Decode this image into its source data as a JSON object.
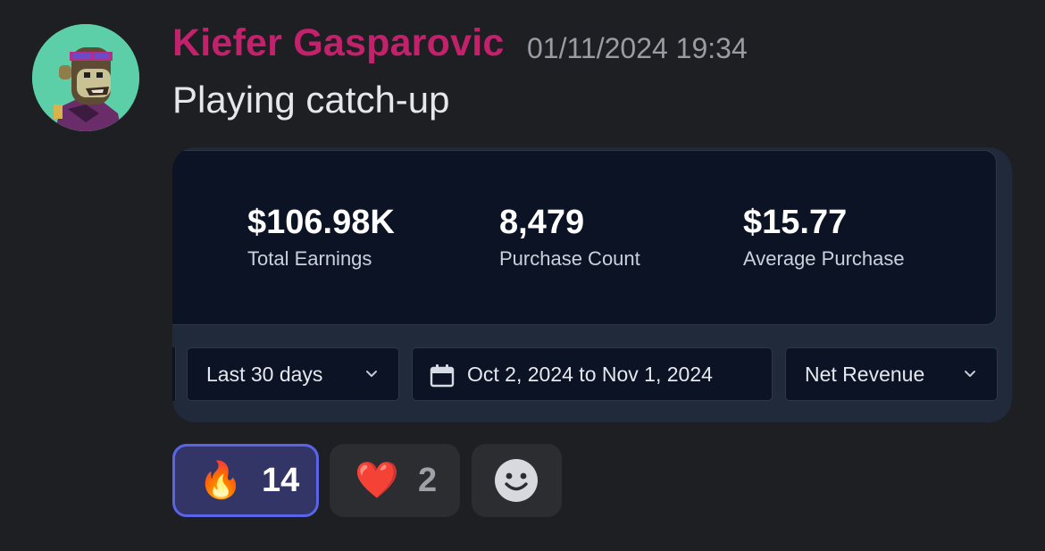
{
  "message": {
    "username": "Kiefer Gasparovic",
    "timestamp": "01/11/2024 19:34",
    "text": "Playing catch-up",
    "username_color": "#c2216b",
    "avatar_icon": "ape-avatar-icon"
  },
  "embed": {
    "stats": [
      {
        "value": "$106.98K",
        "label": "Total Earnings"
      },
      {
        "value": "8,479",
        "label": "Purchase Count"
      },
      {
        "value": "$15.77",
        "label": "Average Purchase"
      }
    ],
    "controls": {
      "range_select": "Last 30 days",
      "date_range": "Oct 2, 2024 to Nov 1, 2024",
      "metric_select": "Net Revenue"
    }
  },
  "reactions": [
    {
      "emoji": "🔥",
      "icon": "fire-emoji-icon",
      "count": "14",
      "active": true
    },
    {
      "emoji": "❤️",
      "icon": "heart-emoji-icon",
      "count": "2",
      "active": false
    },
    {
      "icon": "add-reaction-smiley-icon"
    }
  ]
}
